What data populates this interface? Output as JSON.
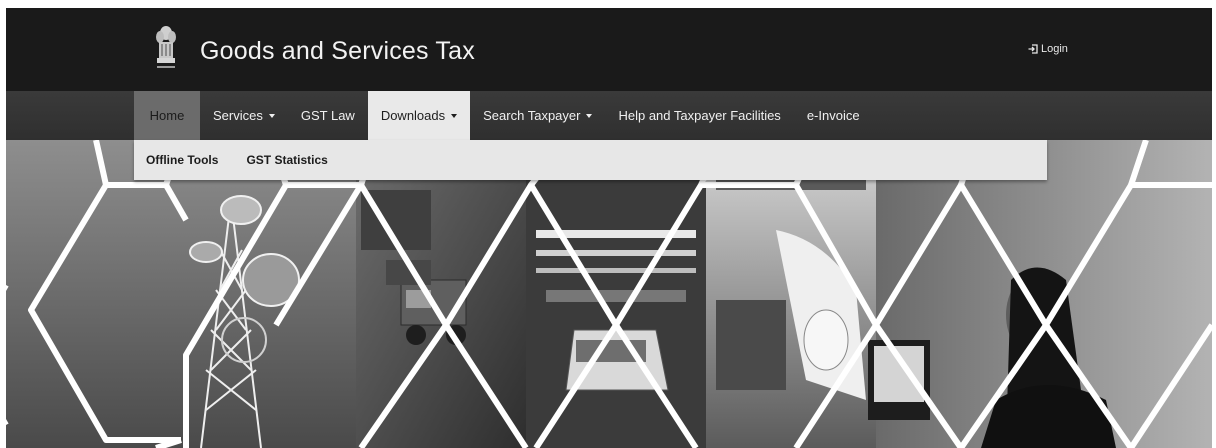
{
  "header": {
    "title": "Goods and Services Tax",
    "login_label": "Login",
    "emblem_icon": "state-emblem-icon",
    "login_icon": "sign-in-icon"
  },
  "nav": {
    "items": [
      {
        "label": "Home",
        "state": "active"
      },
      {
        "label": "Services",
        "dropdown": true
      },
      {
        "label": "GST Law"
      },
      {
        "label": "Downloads",
        "dropdown": true,
        "state": "open"
      },
      {
        "label": "Search Taxpayer",
        "dropdown": true
      },
      {
        "label": "Help and Taxpayer Facilities"
      },
      {
        "label": "e-Invoice"
      }
    ]
  },
  "downloads_menu": {
    "items": [
      {
        "label": "Offline Tools"
      },
      {
        "label": "GST Statistics"
      }
    ]
  },
  "hero": {
    "panels": [
      "telecom-tower",
      "cargo-truck",
      "car-assembly-line",
      "paper-factory",
      "woman-at-computer"
    ]
  },
  "colors": {
    "header_bg": "#1a1a1a",
    "nav_bg": "#353535",
    "active_tab_bg": "#6b6b6b",
    "dropdown_bg": "#e7e7e7"
  }
}
